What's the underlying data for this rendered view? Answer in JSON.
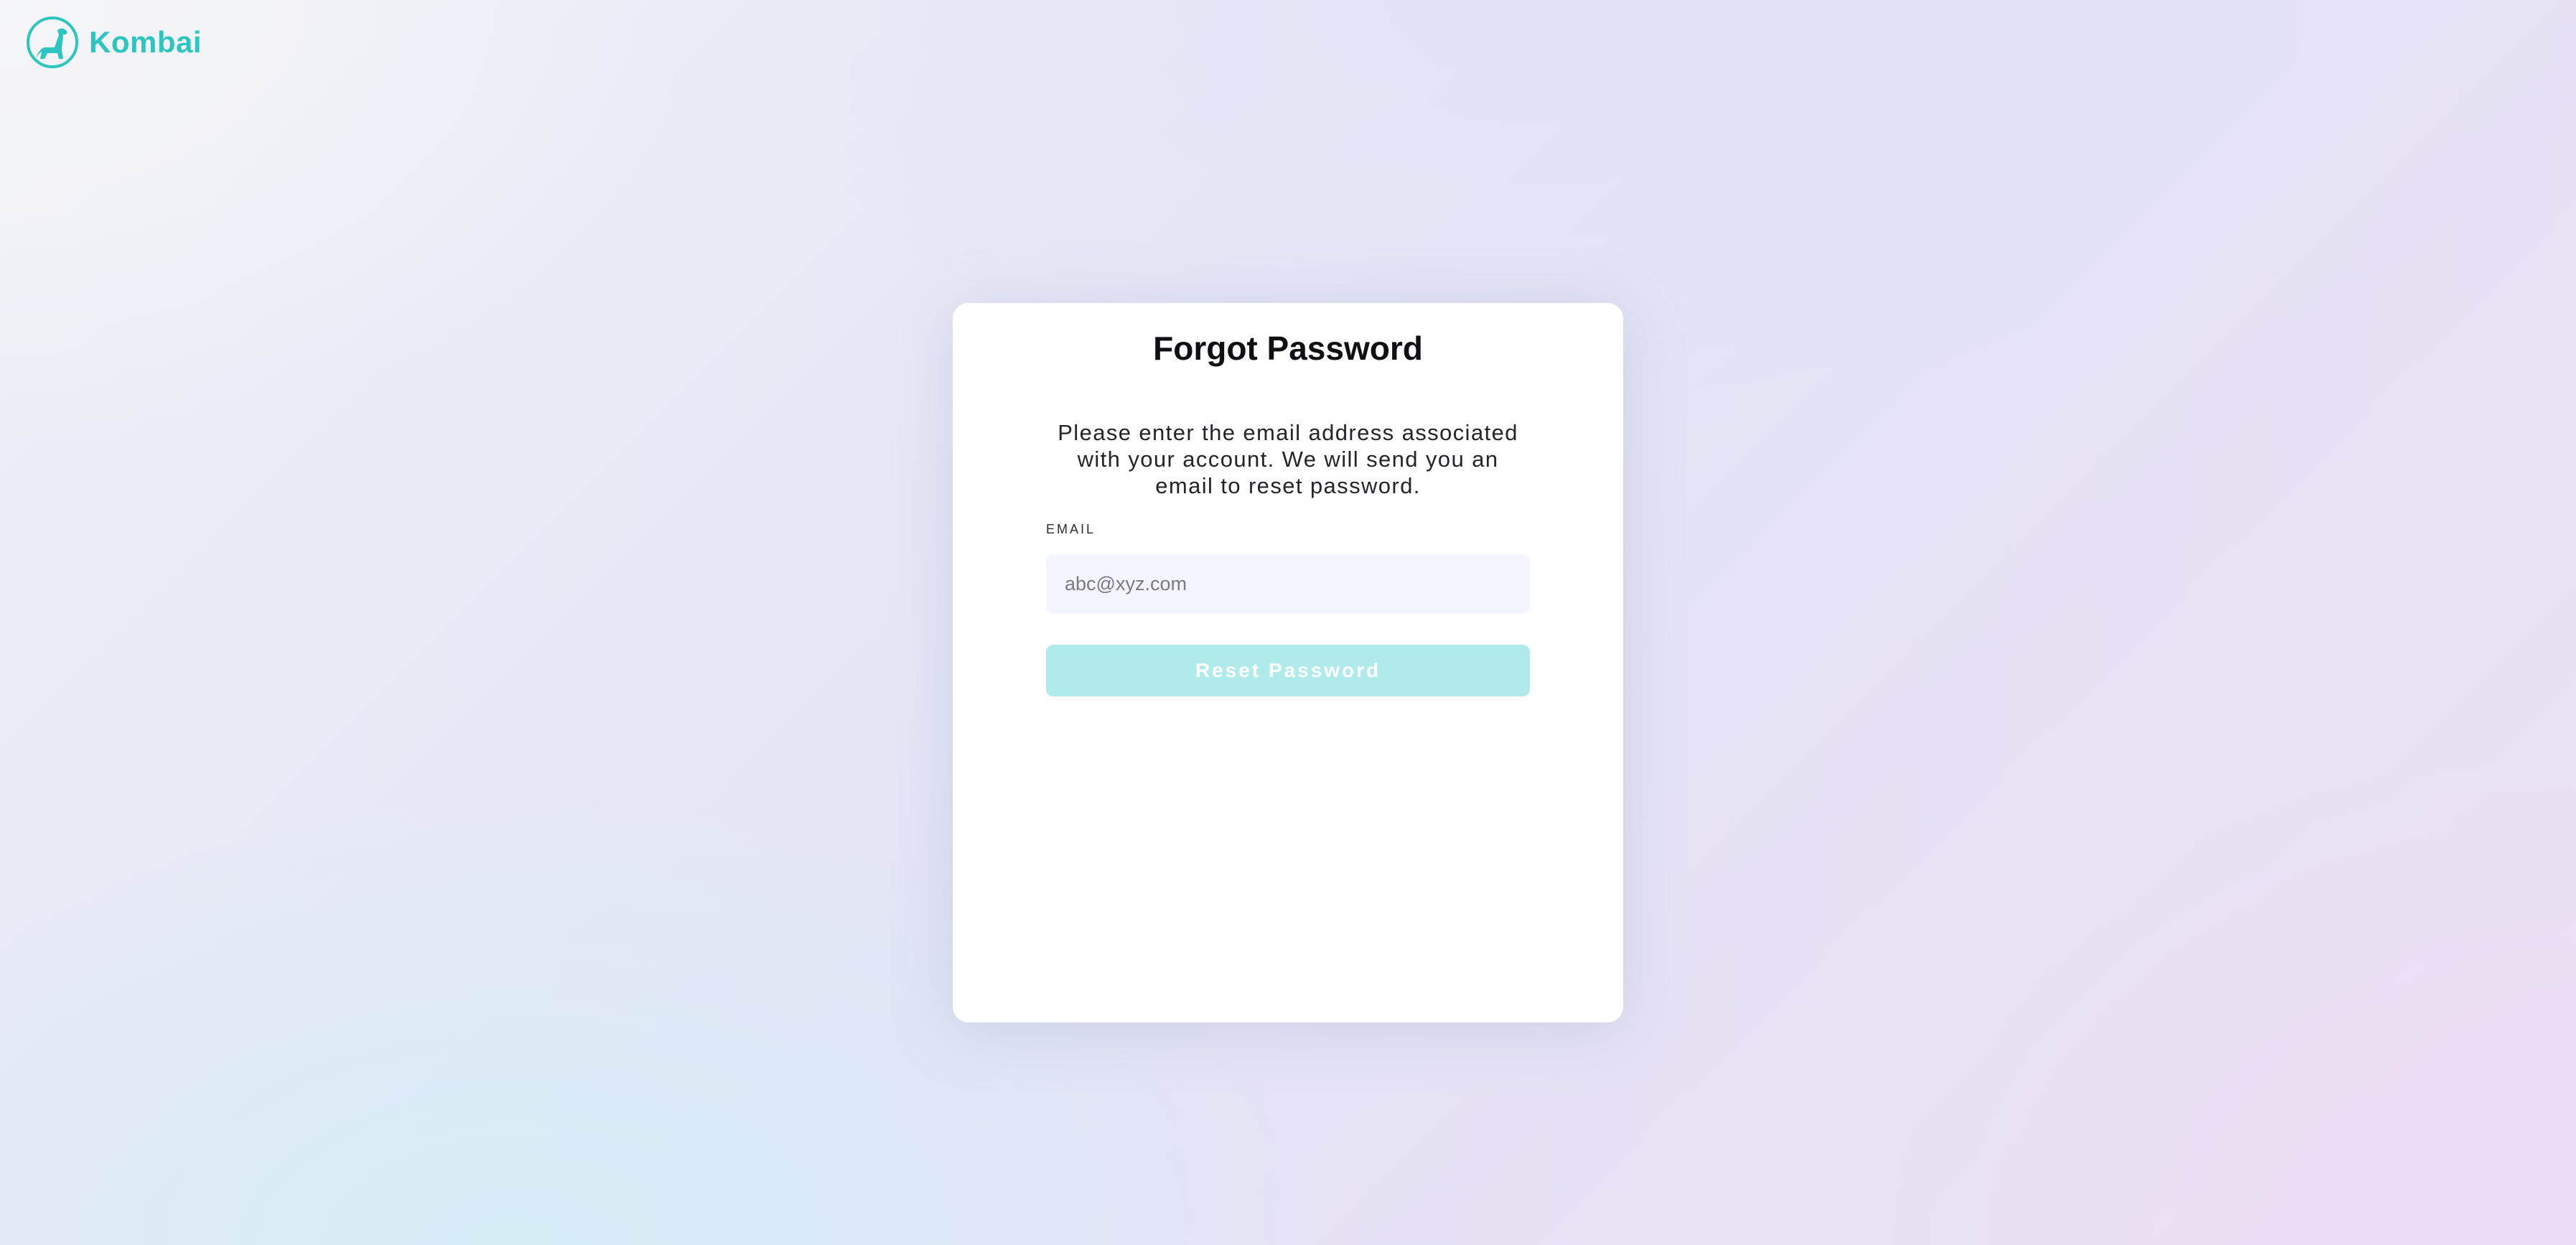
{
  "brand": {
    "name": "Kombai",
    "logo_icon": "dog-logo-icon",
    "color": "#2ec4c0"
  },
  "card": {
    "title": "Forgot Password",
    "description": "Please enter the email address associated with your account. We will send you an email to reset password.",
    "email_label": "EMAIL",
    "email_placeholder": "abc@xyz.com",
    "email_value": "",
    "reset_button_label": "Reset Password",
    "button_color": "#b0eaea"
  }
}
